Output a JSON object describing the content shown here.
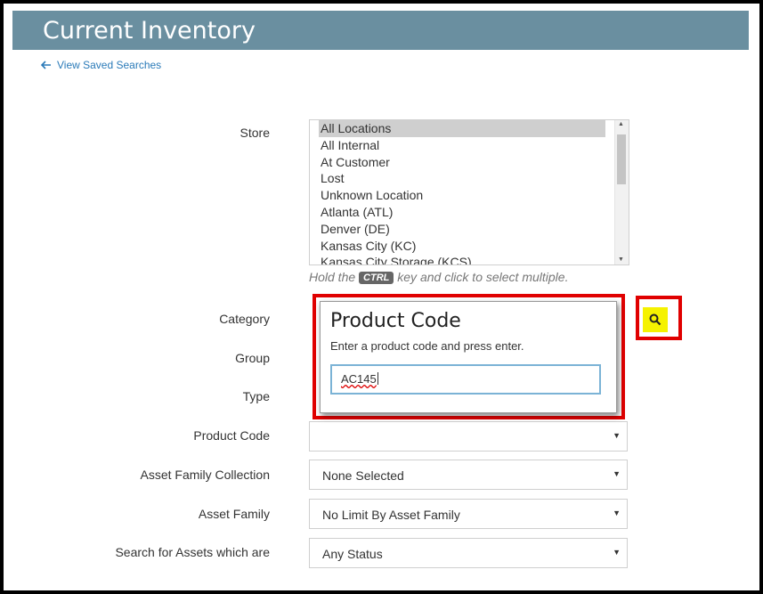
{
  "header": {
    "title": "Current Inventory"
  },
  "back_link": {
    "label": "View Saved Searches"
  },
  "labels": {
    "store": "Store",
    "category": "Category",
    "group": "Group",
    "type": "Type",
    "product_code": "Product Code",
    "asset_family_collection": "Asset Family Collection",
    "asset_family": "Asset Family",
    "search_status": "Search for Assets which are"
  },
  "store_options": [
    "All Locations",
    "All Internal",
    "At Customer",
    "Lost",
    "Unknown Location",
    "Atlanta (ATL)",
    "Denver (DE)",
    "Kansas City (KC)",
    "Kansas City Storage (KCS)"
  ],
  "store_selected": "All Locations",
  "hint": {
    "before": "Hold the",
    "key": "CTRL",
    "after": "key and click to select multiple."
  },
  "selects": {
    "product_code": "",
    "asset_family_collection": "None Selected",
    "asset_family": "No Limit By Asset Family",
    "search_status": "Any Status"
  },
  "popup": {
    "title": "Product Code",
    "description": "Enter a product code and press enter.",
    "input_value": "AC145"
  },
  "colors": {
    "header_bg": "#6a8fa0",
    "link": "#2a7ab8",
    "highlight_outline": "#e00000",
    "search_button": "#f5f200"
  },
  "icons": {
    "back": "arrow-left-icon",
    "search": "search-icon",
    "caret": "caret-down-icon"
  }
}
